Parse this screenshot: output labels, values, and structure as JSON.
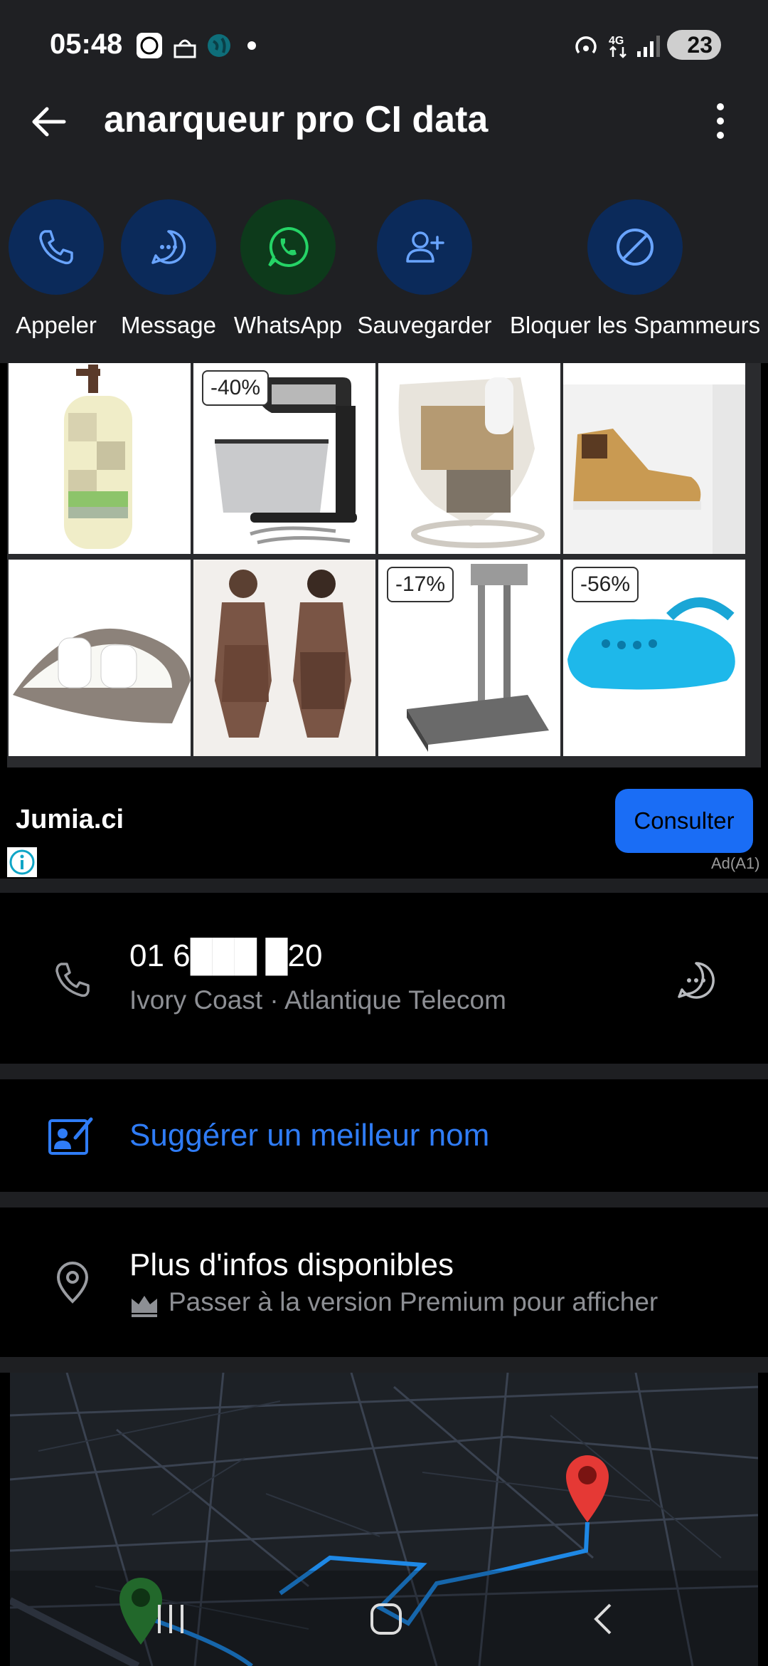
{
  "status_bar": {
    "time": "05:48",
    "battery": "23",
    "icons": [
      "sudo-app-icon",
      "mosque-icon",
      "globe-icon",
      "dot-icon",
      "hotspot-icon",
      "4g-icon",
      "signal-icon",
      "battery-icon"
    ]
  },
  "header": {
    "title": "anarqueur pro CI data"
  },
  "actions": [
    {
      "label": "Appeler",
      "icon": "phone-icon",
      "color": "#0b2a5a"
    },
    {
      "label": "Message",
      "icon": "chat-bubble-icon",
      "color": "#0b2a5a"
    },
    {
      "label": "WhatsApp",
      "icon": "whatsapp-icon",
      "color": "#0d3a1b"
    },
    {
      "label": "Sauvegarder",
      "icon": "add-contact-icon",
      "color": "#0b2a5a"
    },
    {
      "label": "Bloquer les Spammeurs",
      "icon": "block-icon",
      "color": "#0b2a5a"
    }
  ],
  "ad": {
    "products": [
      {
        "name": "lotion-bottle",
        "badge": ""
      },
      {
        "name": "stand-mixer",
        "badge": "-40%"
      },
      {
        "name": "grinder-machine",
        "badge": ""
      },
      {
        "name": "sneaker",
        "badge": ""
      },
      {
        "name": "baby-lounger",
        "badge": ""
      },
      {
        "name": "bodysuit",
        "badge": ""
      },
      {
        "name": "platform-scale",
        "badge": "-17%"
      },
      {
        "name": "clog-shoe",
        "badge": "-56%"
      }
    ],
    "brand": "Jumia.ci",
    "cta": "Consulter",
    "tag": "Ad(A1)"
  },
  "contact": {
    "number": "01 6███ █20",
    "subtitle": "Ivory Coast · Atlantique Telecom"
  },
  "suggest": {
    "label": "Suggérer un meilleur nom"
  },
  "more_info": {
    "title": "Plus d'infos disponibles",
    "premium": "Passer à la version Premium pour afficher"
  },
  "colors": {
    "accent": "#2f7cf6",
    "cta": "#1a6df5",
    "background": "#000000",
    "panel": "#1f2023"
  }
}
